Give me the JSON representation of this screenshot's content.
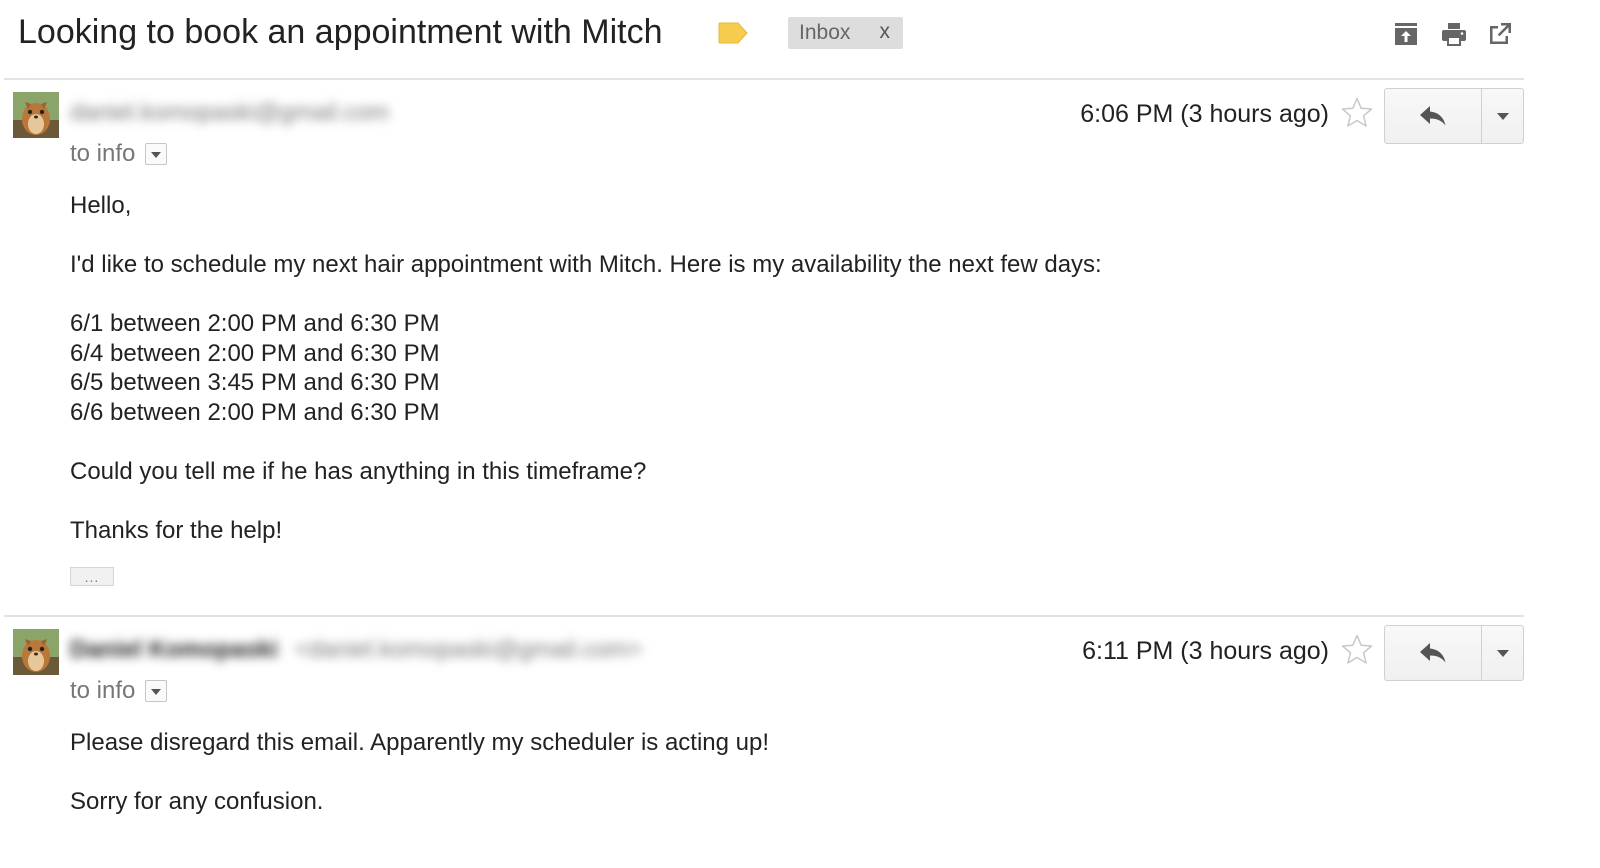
{
  "thread": {
    "subject": "Looking to book an appointment with Mitch",
    "label": "Inbox",
    "label_remove": "x",
    "importance_color": "#f7cb4d"
  },
  "toolbar": {
    "icons": [
      "archive-icon",
      "print-icon",
      "new-window-icon"
    ]
  },
  "messages": [
    {
      "sender_email": "daniel.komopaski@gmail.com",
      "recipient": "to info",
      "timestamp": "6:06 PM (3 hours ago)",
      "body": [
        "Hello,",
        "I'd like to schedule my next hair appointment with Mitch. Here is my availability the next few days:",
        "6/1 between 2:00 PM and 6:30 PM",
        "6/4 between 2:00 PM and 6:30 PM",
        "6/5 between 3:45 PM and 6:30 PM",
        "6/6 between 2:00 PM and 6:30 PM",
        "Could you tell me if he has anything in this timeframe?",
        "Thanks for the help!"
      ],
      "trimmed_content": "..."
    },
    {
      "sender_name": "Daniel Komopaski",
      "sender_email": "<daniel.komopaski@gmail.com>",
      "recipient": "to info",
      "timestamp": "6:11 PM (3 hours ago)",
      "body": [
        "Please disregard this email. Apparently my scheduler is acting up!",
        "Sorry for any confusion."
      ]
    }
  ]
}
